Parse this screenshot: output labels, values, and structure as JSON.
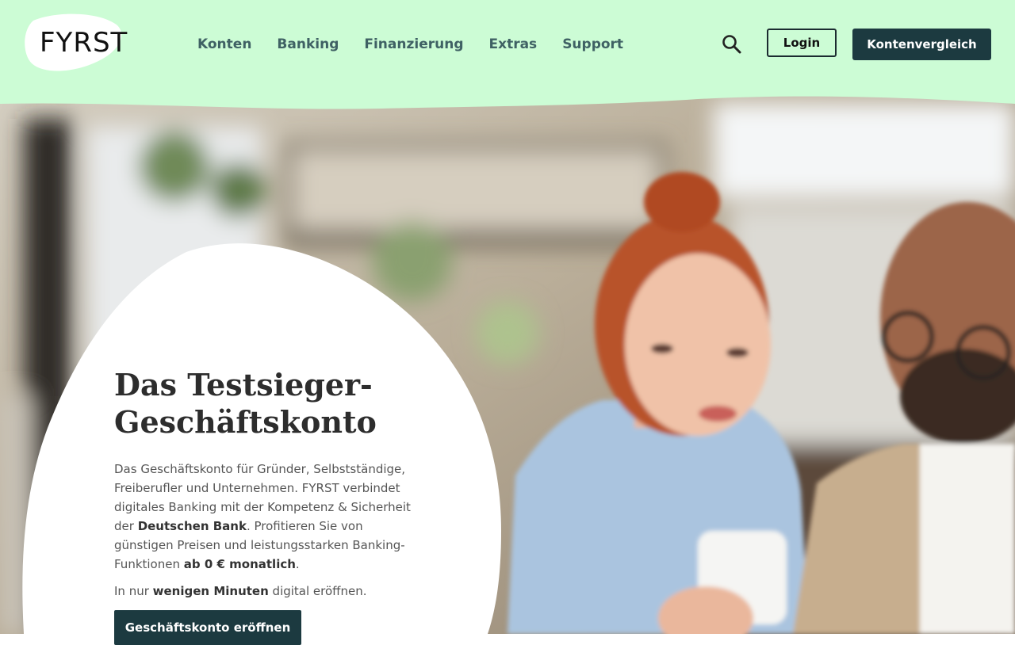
{
  "brand": {
    "logo_text": "FYRST"
  },
  "nav": [
    {
      "label": "Konten"
    },
    {
      "label": "Banking"
    },
    {
      "label": "Finanzierung"
    },
    {
      "label": "Extras"
    },
    {
      "label": "Support"
    }
  ],
  "header": {
    "search_icon": "search-icon",
    "login_label": "Login",
    "compare_label": "Kontenvergleich"
  },
  "hero": {
    "headline_line1": "Das Testsieger-",
    "headline_line2": "Geschäftskonto",
    "intro_1": "Das Geschäftskonto für Gründer, Selbstständige, Freiberufler und Unternehmen. FYRST verbindet digitales Banking mit der Kompetenz & Sicherheit der ",
    "intro_bold_1": "Deutschen Bank",
    "intro_2": ". Profitieren Sie von günstigen Preisen und leistungsstarken Banking-Funktionen ",
    "intro_bold_2": "ab 0 € monatlich",
    "intro_3": ".",
    "note_1": "In nur ",
    "note_bold": "wenigen Minuten",
    "note_2": " digital eröffnen.",
    "cta_label": "Geschäftskonto eröffnen"
  },
  "colors": {
    "header_bg": "#ccfcd5",
    "primary_dark": "#1c3a40",
    "nav_text": "#3f6164"
  }
}
